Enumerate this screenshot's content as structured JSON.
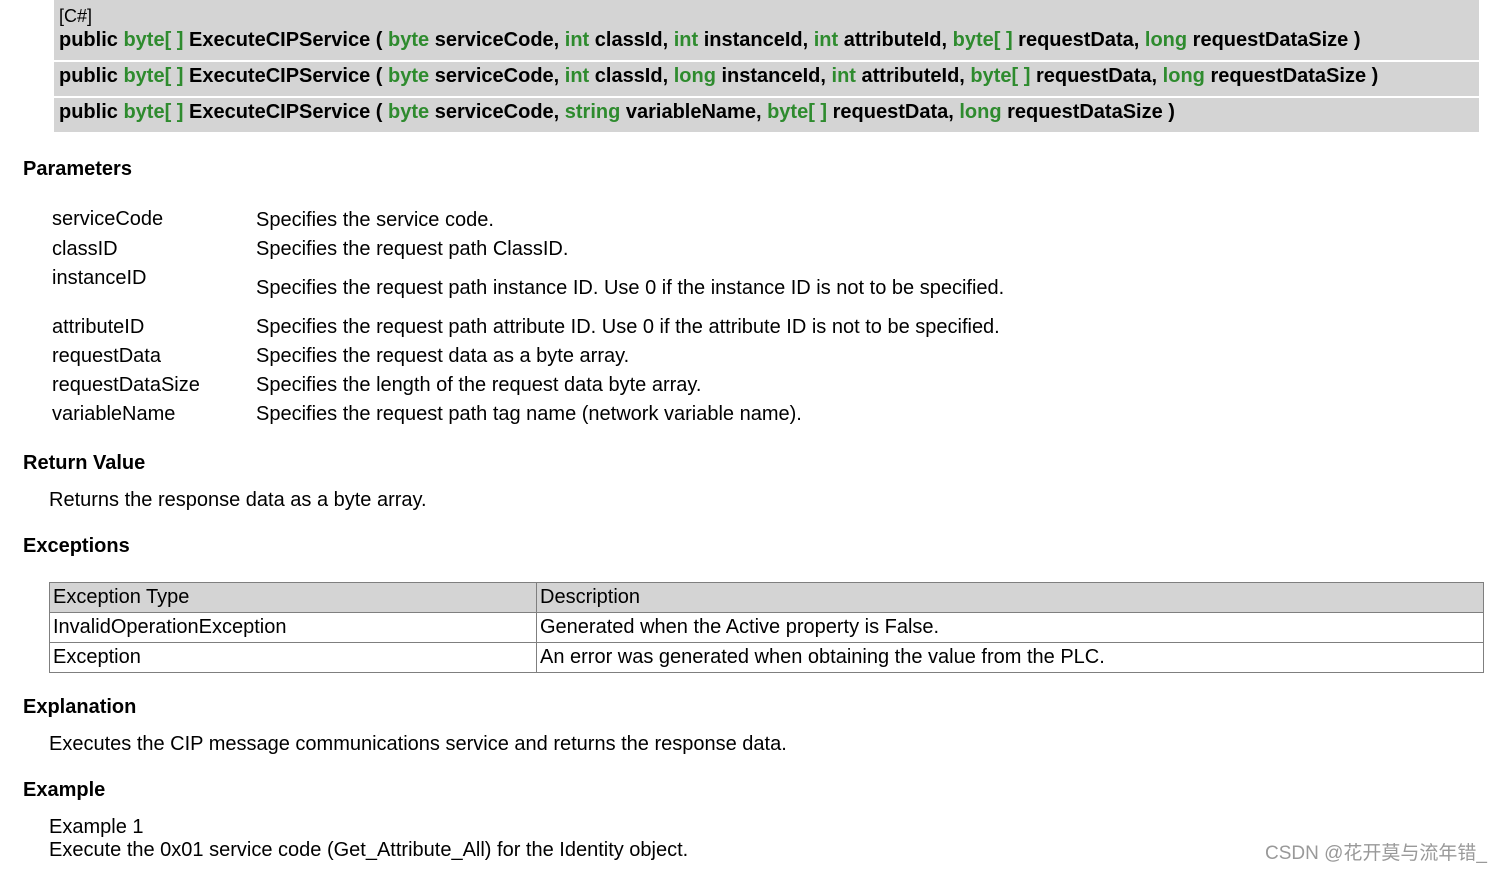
{
  "syntax": {
    "lang": "[C#]",
    "signatures": [
      [
        {
          "t": "public ",
          "k": false
        },
        {
          "t": "byte[ ]",
          "k": true
        },
        {
          "t": " ExecuteCIPService ( ",
          "k": false
        },
        {
          "t": "byte",
          "k": true
        },
        {
          "t": " serviceCode, ",
          "k": false
        },
        {
          "t": "int",
          "k": true
        },
        {
          "t": " classId, ",
          "k": false
        },
        {
          "t": "int",
          "k": true
        },
        {
          "t": " instanceId, ",
          "k": false
        },
        {
          "t": "int",
          "k": true
        },
        {
          "t": " attributeId, ",
          "k": false
        },
        {
          "t": "byte[ ]",
          "k": true
        },
        {
          "t": " requestData, ",
          "k": false
        },
        {
          "t": "long",
          "k": true
        },
        {
          "t": " requestDataSize )",
          "k": false
        }
      ],
      [
        {
          "t": "public ",
          "k": false
        },
        {
          "t": "byte[ ]",
          "k": true
        },
        {
          "t": " ExecuteCIPService ( ",
          "k": false
        },
        {
          "t": "byte",
          "k": true
        },
        {
          "t": " serviceCode, ",
          "k": false
        },
        {
          "t": "int",
          "k": true
        },
        {
          "t": " classId, ",
          "k": false
        },
        {
          "t": "long",
          "k": true
        },
        {
          "t": " instanceId, ",
          "k": false
        },
        {
          "t": "int",
          "k": true
        },
        {
          "t": " attributeId, ",
          "k": false
        },
        {
          "t": "byte[ ]",
          "k": true
        },
        {
          "t": " requestData, ",
          "k": false
        },
        {
          "t": "long",
          "k": true
        },
        {
          "t": " requestDataSize )",
          "k": false
        }
      ],
      [
        {
          "t": "public ",
          "k": false
        },
        {
          "t": "byte[ ]",
          "k": true
        },
        {
          "t": " ExecuteCIPService ( ",
          "k": false
        },
        {
          "t": "byte",
          "k": true
        },
        {
          "t": " serviceCode, ",
          "k": false
        },
        {
          "t": "string",
          "k": true
        },
        {
          "t": " variableName, ",
          "k": false
        },
        {
          "t": "byte[ ]",
          "k": true
        },
        {
          "t": " requestData, ",
          "k": false
        },
        {
          "t": "long",
          "k": true
        },
        {
          "t": " requestDataSize )",
          "k": false
        }
      ]
    ]
  },
  "parameters": {
    "heading": "Parameters",
    "items": [
      {
        "name": "serviceCode",
        "desc": "Specifies the service code."
      },
      {
        "name": "classID",
        "desc": "Specifies the request path ClassID."
      },
      {
        "name": "instanceID",
        "desc": "Specifies the request path instance ID. Use 0 if the instance ID is not to be specified."
      },
      {
        "name": "attributeID",
        "desc": "Specifies the request path attribute ID. Use 0 if the attribute ID is not to be specified."
      },
      {
        "name": "requestData",
        "desc": "Specifies the request data as a byte array."
      },
      {
        "name": "requestDataSize",
        "desc": "Specifies the length of the request data byte array."
      },
      {
        "name": "variableName",
        "desc": "Specifies the request path tag name (network variable name)."
      }
    ]
  },
  "return_value": {
    "heading": "Return Value",
    "text": "Returns the response data as a byte array."
  },
  "exceptions": {
    "heading": "Exceptions",
    "columns": [
      "Exception Type",
      "Description"
    ],
    "rows": [
      [
        "InvalidOperationException",
        "Generated when the Active property is False."
      ],
      [
        "Exception",
        "An error was generated when obtaining the value from the PLC."
      ]
    ]
  },
  "explanation": {
    "heading": "Explanation",
    "text": "Executes the CIP message communications service and returns the response data."
  },
  "example": {
    "heading": "Example",
    "title": "Example 1",
    "text": "Execute the 0x01 service code (Get_Attribute_All) for the Identity object."
  },
  "watermark": "CSDN @花开莫与流年错_",
  "colors": {
    "keyword": "#2e8b2e",
    "syntax_bg": "#d4d4d4",
    "table_header_bg": "#d4d4d4"
  }
}
